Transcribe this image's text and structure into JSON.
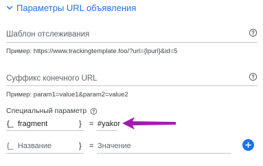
{
  "section": {
    "title": "Параметры URL объявления",
    "icon": "chevron-down-icon"
  },
  "tracking_template": {
    "label": "Шаблон отслеживания",
    "example": "Пример: https://www.trackingtemplate.foo/?url={lpurl}&id=5",
    "help_icon": "help-circle-icon"
  },
  "final_url_suffix": {
    "label": "Суффикс конечного URL",
    "example": "Пример: param1=value1&param2=value2",
    "help_icon": "help-circle-icon"
  },
  "custom_parameter": {
    "label": "Специальный параметр",
    "help_icon": "help-circle-icon",
    "rows": [
      {
        "prefix": "{_",
        "name": "fragment",
        "close": "}",
        "equals": "=",
        "value": "#yakor"
      }
    ],
    "new_row": {
      "prefix": "{_",
      "name_placeholder": "Название",
      "close": "}",
      "equals": "=",
      "value_placeholder": "Значение"
    },
    "add_icon": "plus-icon"
  },
  "annotation": {
    "arrow_icon": "arrow-left-icon",
    "color": "#a21caf"
  },
  "colors": {
    "accent": "#1a73e8",
    "text_secondary": "#5f6368",
    "divider": "#c4c7c5"
  }
}
